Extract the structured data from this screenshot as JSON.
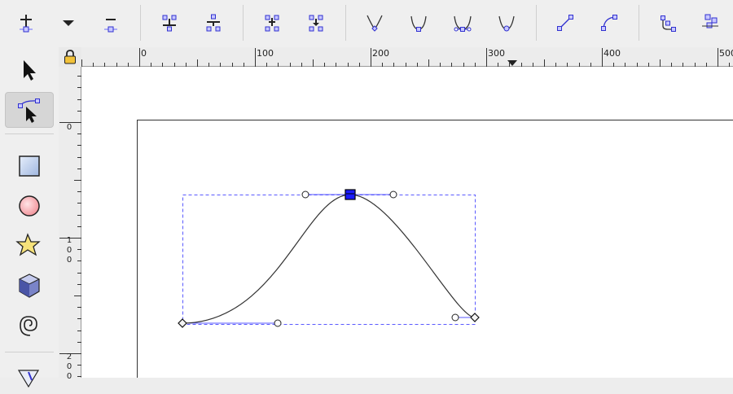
{
  "toolbar": {
    "buttons": [
      {
        "name": "insert-node-icon"
      },
      {
        "name": "insert-node-dropdown-icon"
      },
      {
        "name": "delete-node-icon"
      },
      {
        "name": "join-nodes-icon"
      },
      {
        "name": "break-path-icon"
      },
      {
        "name": "join-segment-icon"
      },
      {
        "name": "delete-segment-icon"
      },
      {
        "name": "make-cusp-node-icon"
      },
      {
        "name": "make-smooth-node-icon"
      },
      {
        "name": "make-symmetric-node-icon"
      },
      {
        "name": "auto-smooth-node-icon"
      },
      {
        "name": "make-segment-line-icon"
      },
      {
        "name": "make-segment-curve-icon"
      },
      {
        "name": "object-to-path-icon"
      },
      {
        "name": "stroke-to-path-icon"
      }
    ]
  },
  "toolbox": {
    "tools": [
      {
        "name": "selector-tool-icon",
        "active": false
      },
      {
        "name": "node-tool-icon",
        "active": true
      },
      {
        "name": "rectangle-tool-icon",
        "active": false
      },
      {
        "name": "ellipse-tool-icon",
        "active": false
      },
      {
        "name": "star-tool-icon",
        "active": false
      },
      {
        "name": "3d-box-tool-icon",
        "active": false
      },
      {
        "name": "spiral-tool-icon",
        "active": false
      },
      {
        "name": "pencil-tool-icon",
        "active": false
      }
    ]
  },
  "rulers": {
    "horizontal_labels": [
      "0",
      "100",
      "200",
      "300",
      "400",
      "500"
    ],
    "vertical_labels": [
      [
        "0"
      ],
      [
        "1",
        "0",
        "0"
      ],
      [
        "2",
        "0",
        "0"
      ]
    ]
  },
  "colors": {
    "node_blue": "#1a1aff",
    "selection_dash": "#5a5aff",
    "path_stroke": "#333333"
  }
}
